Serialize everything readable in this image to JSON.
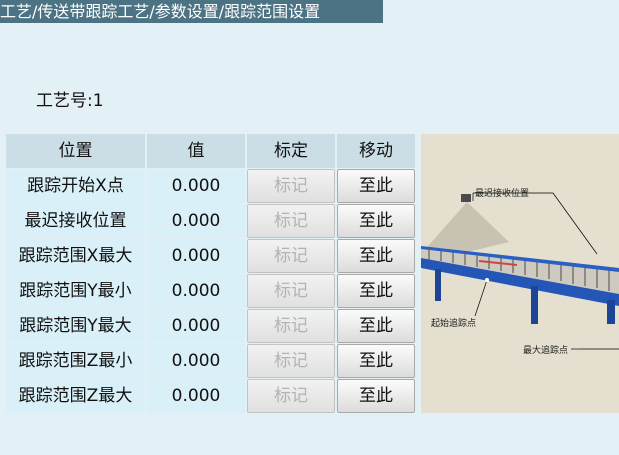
{
  "breadcrumb": "工艺/传送带跟踪工艺/参数设置/跟踪范围设置",
  "process_number": "工艺号:1",
  "table": {
    "headers": [
      "位置",
      "值",
      "标定",
      "移动"
    ],
    "rows": [
      {
        "name": "跟踪开始X点",
        "value": "0.000",
        "mark": "标记",
        "move": "至此"
      },
      {
        "name": "最迟接收位置",
        "value": "0.000",
        "mark": "标记",
        "move": "至此"
      },
      {
        "name": "跟踪范围X最大",
        "value": "0.000",
        "mark": "标记",
        "move": "至此"
      },
      {
        "name": "跟踪范围Y最小",
        "value": "0.000",
        "mark": "标记",
        "move": "至此"
      },
      {
        "name": "跟踪范围Y最大",
        "value": "0.000",
        "mark": "标记",
        "move": "至此"
      },
      {
        "name": "跟踪范围Z最小",
        "value": "0.000",
        "mark": "标记",
        "move": "至此"
      },
      {
        "name": "跟踪范围Z最大",
        "value": "0.000",
        "mark": "标记",
        "move": "至此"
      }
    ]
  },
  "illustration": {
    "labels": {
      "latest_receive": "最迟接收位置",
      "start_track": "起始追踪点",
      "max_track": "最大追踪点"
    }
  },
  "colors": {
    "title_bar": "#4c7384",
    "background": "#e3f1f7",
    "header_cell": "#ccdee5",
    "data_cell": "#d9f0f8",
    "conveyor_frame": "#2456b8"
  }
}
